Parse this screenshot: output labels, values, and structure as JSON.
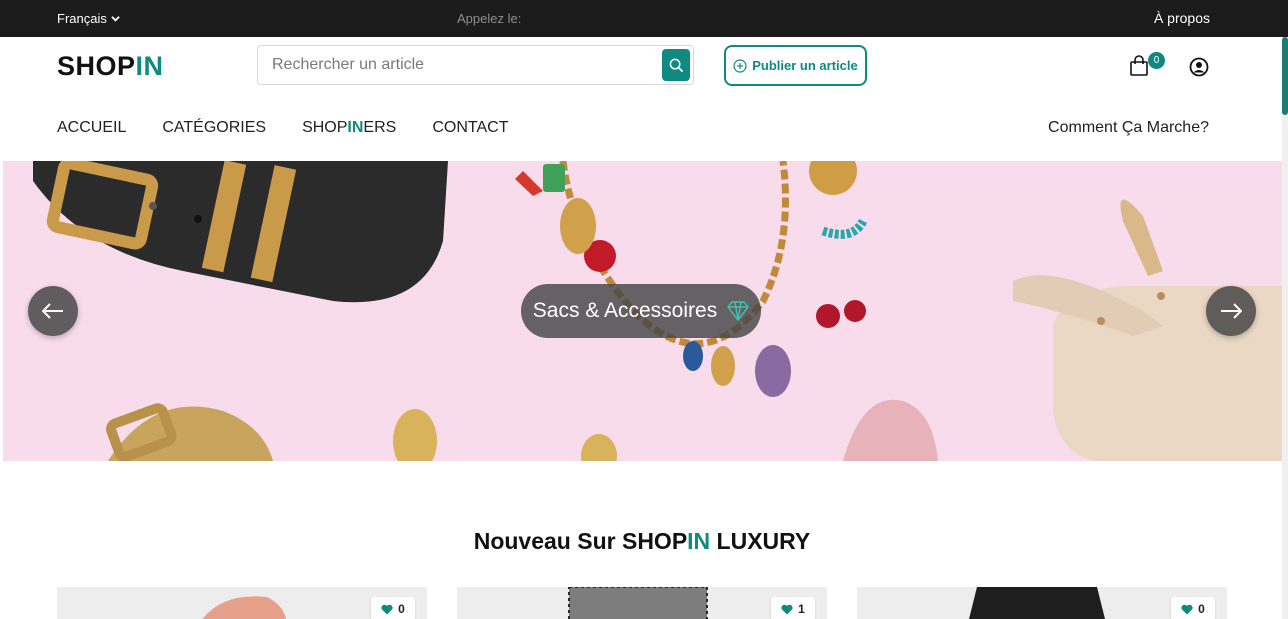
{
  "topbar": {
    "language": "Français",
    "phone_label": "Appelez le:",
    "about": "À propos"
  },
  "brand": {
    "logo_main": "SHOP",
    "logo_accent": "IN"
  },
  "search": {
    "placeholder": "Rechercher un article"
  },
  "publish_label": "Publier un article",
  "cart": {
    "count": "0"
  },
  "nav": {
    "home": "ACCUEIL",
    "categories": "CATÉGORIES",
    "shopiners_pre": "SHOP",
    "shopiners_accent": "IN",
    "shopiners_post": "ERS",
    "contact": "CONTACT",
    "how_it_works": "Comment Ça Marche?"
  },
  "hero": {
    "title": "Sacs & Accessoires"
  },
  "section": {
    "title_pre": "Nouveau Sur ",
    "title_brand_main": "SHOP",
    "title_brand_accent": "IN",
    "title_post": " LUXURY"
  },
  "products": [
    {
      "likes": "0"
    },
    {
      "likes": "1"
    },
    {
      "likes": "0"
    }
  ],
  "colors": {
    "accent": "#0f8a80",
    "topbar": "#1b1b1b",
    "hero_bg": "#f9dcec"
  },
  "icons": [
    "chevron-down-icon",
    "search-icon",
    "plus-circle-icon",
    "shopping-bag-icon",
    "user-circle-icon",
    "diamond-icon",
    "arrow-left-icon",
    "arrow-right-icon",
    "heart-icon"
  ]
}
